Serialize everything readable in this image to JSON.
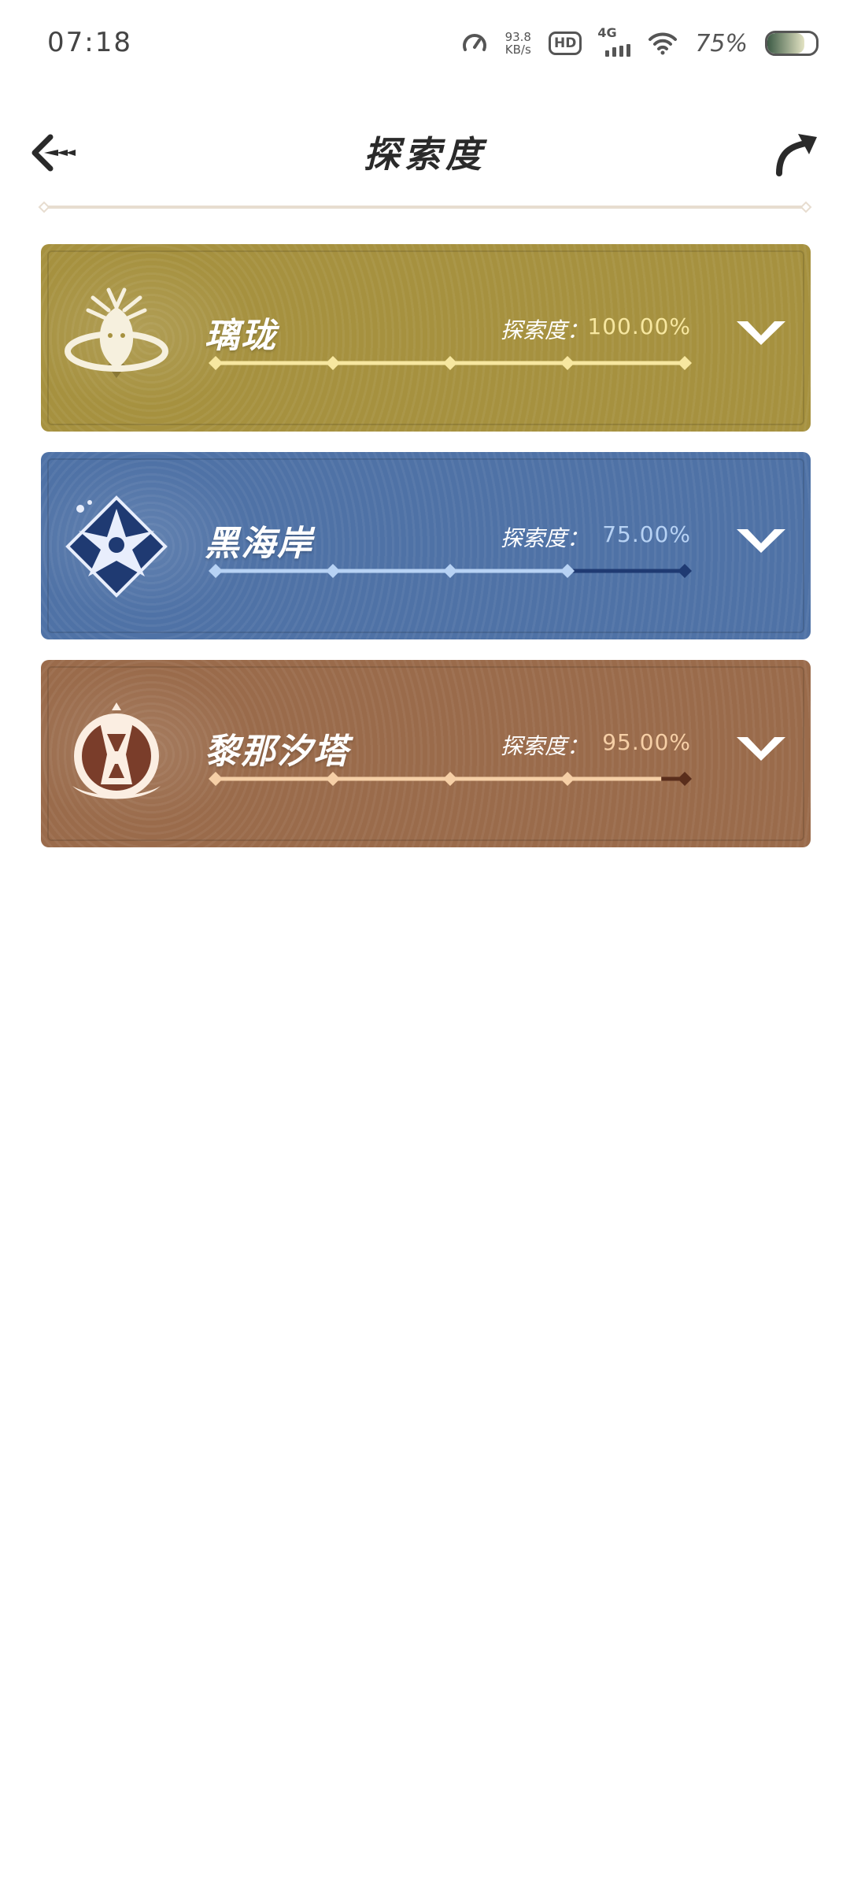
{
  "status_bar": {
    "time": "07:18",
    "net_speed_value": "93.8",
    "net_speed_unit": "KB/s",
    "hd": "HD",
    "network": "4G",
    "battery_percent": "75%",
    "battery_level": 0.75
  },
  "header": {
    "title": "探索度",
    "back_icon": "back-arrow-icon",
    "share_icon": "share-arrow-icon"
  },
  "regions": [
    {
      "name": "璃珑",
      "label": "探索度：",
      "value": "100.00%",
      "progress": 1.0,
      "colors": {
        "card": "#a6913f",
        "fill": "#f7e7a0",
        "rest": "#6b5a1f",
        "value_text": "#f7e7a0"
      }
    },
    {
      "name": "黑海岸",
      "label": "探索度：",
      "value": "75.00%",
      "progress": 0.75,
      "colors": {
        "card": "#4f72a6",
        "fill": "#b7d2f4",
        "rest": "#1f3a72",
        "value_text": "#b7d2f4"
      }
    },
    {
      "name": "黎那汐塔",
      "label": "探索度：",
      "value": "95.00%",
      "progress": 0.95,
      "colors": {
        "card": "#9a6b4b",
        "fill": "#f6cfa6",
        "rest": "#5a2e1c",
        "value_text": "#f6cfa6"
      }
    }
  ]
}
